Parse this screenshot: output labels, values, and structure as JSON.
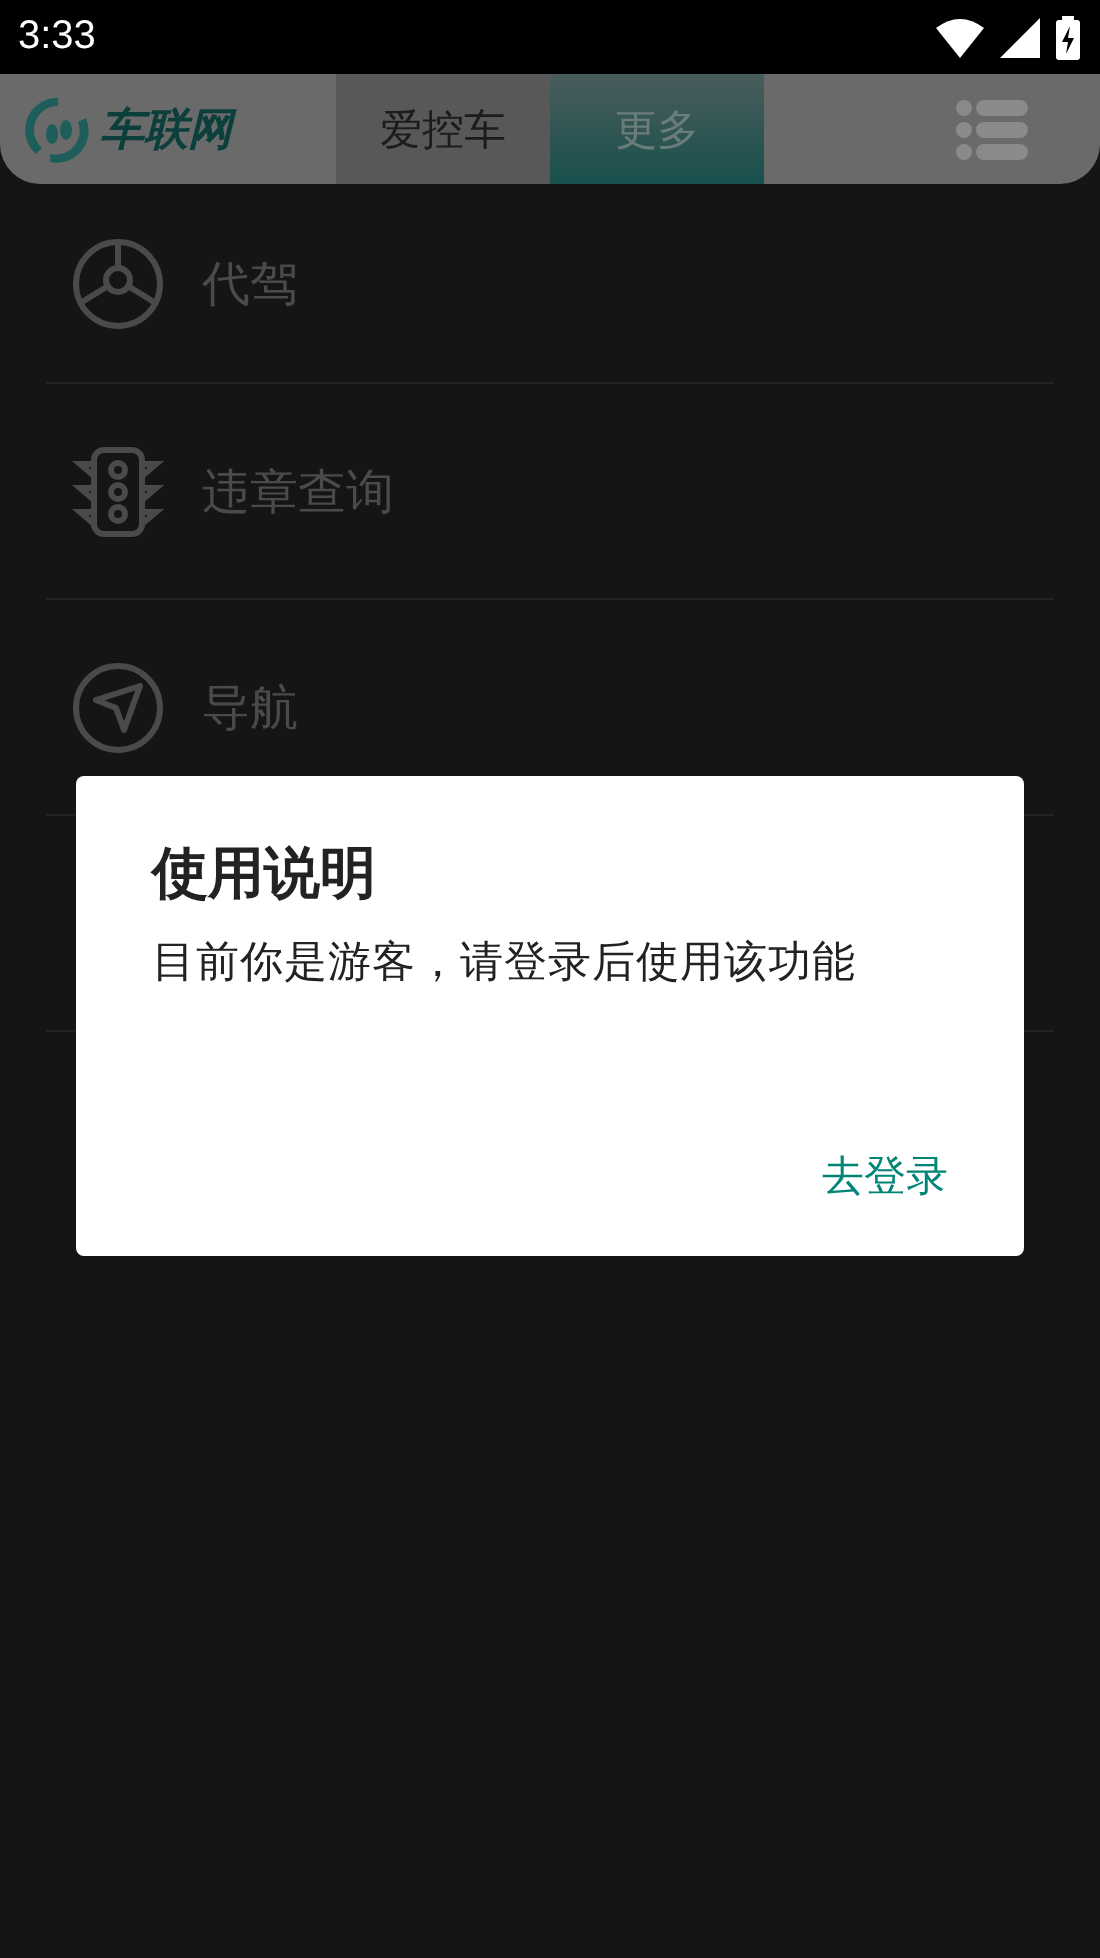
{
  "status_bar": {
    "time": "3:33"
  },
  "header": {
    "logo_text": "车联网",
    "tabs": [
      {
        "label": "爱控车",
        "selected": false
      },
      {
        "label": "更多",
        "selected": true
      }
    ]
  },
  "menu_items": [
    {
      "label": "代驾"
    },
    {
      "label": "违章查询"
    },
    {
      "label": "导航"
    }
  ],
  "dialog": {
    "title": "使用说明",
    "message": "目前你是游客，请登录后使用该功能",
    "actions": [
      "去登录"
    ]
  }
}
